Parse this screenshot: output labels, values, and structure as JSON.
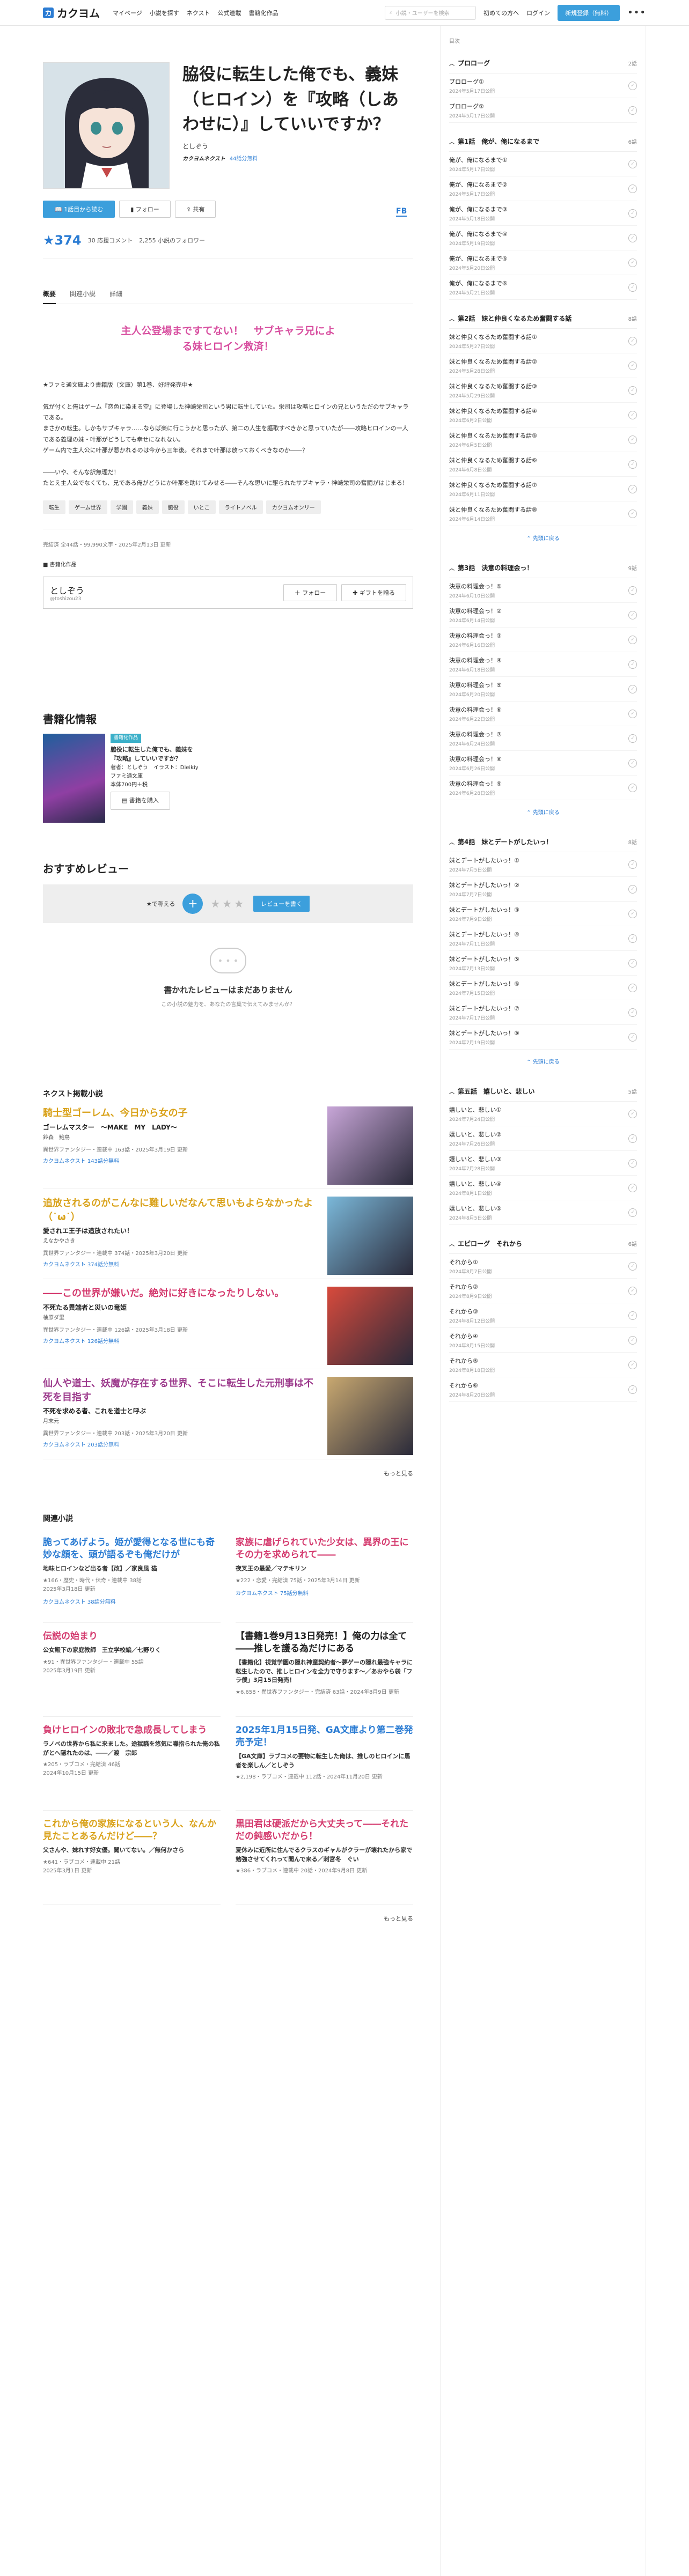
{
  "header": {
    "logo": "カクヨム",
    "nav": [
      "マイページ",
      "小説を探す",
      "ネクスト",
      "公式連載",
      "書籍化作品"
    ],
    "search_placeholder": "小説・ユーザーを検索",
    "beginner": "初めての方へ",
    "login": "ログイン",
    "signup": "新規登録（無料）"
  },
  "work": {
    "title": "脇役に転生した俺でも、義妹（ヒロイン）を『攻略（しあわせに）』していいですか？",
    "author": "としぞう",
    "badge": "カクヨムネクスト",
    "badge_sub": "44話分無料",
    "fb": "FB",
    "read_btn": "1話目から読む",
    "follow_btn": "フォロー",
    "share_btn": "共有",
    "stars": "★374",
    "comments": "30 応援コメント",
    "followers": "2,255 小説のフォロワー"
  },
  "tabs": [
    "概要",
    "関連小説",
    "詳細"
  ],
  "catchphrase": "主人公登場まですてない！　サブキャラ兄によ\nる妹ヒロイン救済！",
  "intro": "★ファミ通文庫より書籍版（文庫）第1巻、好評発売中★\n\n気が付くと俺はゲーム『恋色に染まる空』に登場した神崎栄司という男に転生していた。栄司は攻略ヒロインの兄というただのサブキャラである。\nまさかの転生。しかもサブキャラ……ならば楽に行こうかと思ったが、第二の人生を謳歌すべきかと思っていたが――攻略ヒロインの一人である義理の妹・叶那がどうしても幸せになれない。\nゲーム内で主人公に叶那が惹かれるのは今から三年後。それまで叶那は放っておくべきなのか――？\n\n――いや、そんな訳無理だ！\nたとえ主人公でなくても、兄である俺がどうにか叶那を助けてみせる――そんな思いに駆られたサブキャラ・神崎栄司の奮闘がはじまる！",
  "tags": [
    "転生",
    "ゲーム世界",
    "学園",
    "義妹",
    "脇役",
    "いとこ",
    "ライトノベル",
    "カクヨムオンリー"
  ],
  "meta": "完結済 全44話・99,990文字・2025年2月13日 更新",
  "book_flag": "書籍化作品",
  "author_box": {
    "name": "としぞう",
    "handle": "@toshizou23",
    "follow": "フォロー",
    "gift": "ギフトを贈る"
  },
  "book_section": {
    "title": "書籍化情報",
    "pill": "書籍化作品",
    "book_title": "脇役に転生した俺でも、義妹を『攻略』していいですか？",
    "by": "著者：としぞう　イラスト：Dieikiy",
    "label": "ファミ通文庫",
    "price": "本体700円＋税",
    "buy": "書籍を購入"
  },
  "review": {
    "title": "おすすめレビュー",
    "prompt": "★で称える",
    "write": "レビューを書く",
    "empty_title": "書かれたレビューはまだありません",
    "empty_sub": "この小説の魅力を、あなたの言葉で伝えてみませんか？"
  },
  "next_section": {
    "title": "ネクスト掲載小説",
    "items": [
      {
        "catch": "騎士型ゴーレム、今日から女の子",
        "title": "ゴーレムマスター　～MAKE　MY　LADY～",
        "author": "鈴森　鮑鳥",
        "meta": "異世界ファンタジー・連載中 163話・2025年3月19日 更新",
        "free": "カクヨムネクスト 143話分無料",
        "color": "#d9a21a"
      },
      {
        "catch": "追放されるのがこんなに難しいだなんて思いもよらなかったよ（˙ω˙）",
        "title": "愛されエ王子は追放されたい！",
        "author": "えなかやさき",
        "meta": "異世界ファンタジー・連載中 374話・2025年3月20日 更新",
        "free": "カクヨムネクスト 374話分無料",
        "color": "#d9a21a"
      },
      {
        "catch": "――この世界が嫌いだ。絶対に好きになったりしない。",
        "title": "不死たる異端者と災いの竜姫",
        "author": "柚原ダ里",
        "meta": "異世界ファンタジー・連載中 126話・2025年3月18日 更新",
        "free": "カクヨムネクスト 126話分無料",
        "color": "#d43a6e"
      },
      {
        "catch": "仙人や道士、妖魔が存在する世界、そこに転生した元刑事は不死を目指す",
        "title": "不死を求める者、これを道士と呼ぶ",
        "author": "月末元",
        "meta": "異世界ファンタジー・連載中 203話・2025年3月20日 更新",
        "free": "カクヨムネクスト 203話分無料",
        "color": "#9c3a8c"
      }
    ],
    "more": "もっと見る"
  },
  "related": {
    "title": "関連小説",
    "items": [
      {
        "catch": "脆ってあげよう。姫が愛得となる世にも奇妙な顔を、頭が語るぞも俺だけが",
        "title": "地味ヒロインなど出る者【改】／家良風 猫",
        "meta": "★166・歴史・時代・伝奇・連載中 38話\n2025年3月18日 更新",
        "free": "カクヨムネクスト 38話分無料",
        "color": "#2b7cd3"
      },
      {
        "catch": "家族に虐げられていた少女は、異界の王にその力を求められて――",
        "title": "夜叉王の最愛／マテキリン",
        "meta": "★222・恋愛・完結済 75話・2025年3月14日 更新",
        "free": "カクヨムネクスト 75話分無料",
        "color": "#d43a6e"
      },
      {
        "catch": "伝説の始まり",
        "title": "公女殿下の家庭教師　王立学校編／七野りく",
        "meta": "★91・異世界ファンタジー・連載中 55話\n2025年3月19日 更新",
        "free": "",
        "color": "#d43a6e"
      },
      {
        "catch": "【書籍1巻9月13日発売！】俺の力は全て――推しを護る為だけにある",
        "title": "【書籍化】視覚学園の隠れ神童契約者〜夢ゲーの隠れ最強キャラに転生したので、推しヒロインを全力で守ります〜／あおやら袋「フラ僕」3月15日発売！",
        "meta": "★6,658・異世界ファンタジー・完結済 63話・2024年8月9日 更新",
        "free": "",
        "color": "#222"
      },
      {
        "catch": "負けヒロインの敗北で急成長してしまう",
        "title": "ラノベの世界から私に来ました。途獄騒を悠気に囃指られた俺の私がとへ隠れたのは、――／渡　宗郎",
        "meta": "★205・ラブコメ・完結済 46話\n2024年10月15日 更新",
        "free": "",
        "color": "#d43a6e"
      },
      {
        "catch": "2025年1月15日発、GA文庫より第二巻発売予定！",
        "title": "【GA文庫】ラブコメの要物に転生した俺は、推しのヒロインに馬者を楽しん／としぞう",
        "meta": "★2,198・ラブコメ・連載中 112話・2024年11月20日 更新",
        "free": "",
        "color": "#2b7cd3"
      },
      {
        "catch": "これから俺の家族になるという人、なんか見たことあるんだけど――？",
        "title": "父さんや、妹れす好女優。聞いてない。／無何かさら",
        "meta": "★641・ラブコメ・連載中 21話\n2025年3月1日 更新",
        "free": "",
        "color": "#d9a21a"
      },
      {
        "catch": "黒田君は硬派だから大丈夫って――それただの鈍感いだから！",
        "title": "夏休みに近所に住んでるクラスのギャルがクラーが壊れたから家で勉強させてくれって聞んで来る／刺宮冬　ぐい",
        "meta": "★386・ラブコメ・連載中 20話・2024年9月8日 更新",
        "free": "",
        "color": "#d43a6e"
      }
    ],
    "more": "もっと見る"
  },
  "sidebar": {
    "label": "目次",
    "collapse": "先頭に戻る",
    "chapters": [
      {
        "title": "プロローグ",
        "count": "2話",
        "episodes": [
          {
            "t": "プロローグ①",
            "d": "2024年5月17日公開"
          },
          {
            "t": "プロローグ②",
            "d": "2024年5月17日公開"
          }
        ],
        "collapse": false
      },
      {
        "title": "第1話　俺が、俺になるまで",
        "count": "6話",
        "episodes": [
          {
            "t": "俺が、俺になるまで①",
            "d": "2024年5月17日公開"
          },
          {
            "t": "俺が、俺になるまで②",
            "d": "2024年5月17日公開"
          },
          {
            "t": "俺が、俺になるまで③",
            "d": "2024年5月18日公開"
          },
          {
            "t": "俺が、俺になるまで④",
            "d": "2024年5月19日公開"
          },
          {
            "t": "俺が、俺になるまで⑤",
            "d": "2024年5月20日公開"
          },
          {
            "t": "俺が、俺になるまで⑥",
            "d": "2024年5月21日公開"
          }
        ],
        "collapse": false
      },
      {
        "title": "第2話　妹と仲良くなるため奮闘する話",
        "count": "8話",
        "episodes": [
          {
            "t": "妹と仲良くなるため奮闘する話①",
            "d": "2024年5月27日公開"
          },
          {
            "t": "妹と仲良くなるため奮闘する話②",
            "d": "2024年5月28日公開"
          },
          {
            "t": "妹と仲良くなるため奮闘する話③",
            "d": "2024年5月29日公開"
          },
          {
            "t": "妹と仲良くなるため奮闘する話④",
            "d": "2024年6月2日公開"
          },
          {
            "t": "妹と仲良くなるため奮闘する話⑤",
            "d": "2024年6月5日公開"
          },
          {
            "t": "妹と仲良くなるため奮闘する話⑥",
            "d": "2024年6月8日公開"
          },
          {
            "t": "妹と仲良くなるため奮闘する話⑦",
            "d": "2024年6月11日公開"
          },
          {
            "t": "妹と仲良くなるため奮闘する話⑧",
            "d": "2024年6月14日公開"
          }
        ],
        "collapse": true
      },
      {
        "title": "第3話　決意の料理会っ！",
        "count": "9話",
        "episodes": [
          {
            "t": "決意の料理会っ！①",
            "d": "2024年6月10日公開"
          },
          {
            "t": "決意の料理会っ！②",
            "d": "2024年6月14日公開"
          },
          {
            "t": "決意の料理会っ！③",
            "d": "2024年6月16日公開"
          },
          {
            "t": "決意の料理会っ！④",
            "d": "2024年6月18日公開"
          },
          {
            "t": "決意の料理会っ！⑤",
            "d": "2024年6月20日公開"
          },
          {
            "t": "決意の料理会っ！⑥",
            "d": "2024年6月22日公開"
          },
          {
            "t": "決意の料理会っ！⑦",
            "d": "2024年6月24日公開"
          },
          {
            "t": "決意の料理会っ！⑧",
            "d": "2024年6月26日公開"
          },
          {
            "t": "決意の料理会っ！⑨",
            "d": "2024年6月28日公開"
          }
        ],
        "collapse": true
      },
      {
        "title": "第4話　妹とデートがしたいっ！",
        "count": "8話",
        "episodes": [
          {
            "t": "妹とデートがしたいっ！①",
            "d": "2024年7月5日公開"
          },
          {
            "t": "妹とデートがしたいっ！②",
            "d": "2024年7月7日公開"
          },
          {
            "t": "妹とデートがしたいっ！③",
            "d": "2024年7月9日公開"
          },
          {
            "t": "妹とデートがしたいっ！④",
            "d": "2024年7月11日公開"
          },
          {
            "t": "妹とデートがしたいっ！⑤",
            "d": "2024年7月13日公開"
          },
          {
            "t": "妹とデートがしたいっ！⑥",
            "d": "2024年7月15日公開"
          },
          {
            "t": "妹とデートがしたいっ！⑦",
            "d": "2024年7月17日公開"
          },
          {
            "t": "妹とデートがしたいっ！⑧",
            "d": "2024年7月19日公開"
          }
        ],
        "collapse": true
      },
      {
        "title": "第五話　嬉しいと、悲しい",
        "count": "5話",
        "episodes": [
          {
            "t": "嬉しいと、悲しい①",
            "d": "2024年7月24日公開"
          },
          {
            "t": "嬉しいと、悲しい②",
            "d": "2024年7月26日公開"
          },
          {
            "t": "嬉しいと、悲しい③",
            "d": "2024年7月28日公開"
          },
          {
            "t": "嬉しいと、悲しい④",
            "d": "2024年8月1日公開"
          },
          {
            "t": "嬉しいと、悲しい⑤",
            "d": "2024年8月5日公開"
          }
        ],
        "collapse": false
      },
      {
        "title": "エピローグ　それから",
        "count": "6話",
        "episodes": [
          {
            "t": "それから①",
            "d": "2024年8月7日公開"
          },
          {
            "t": "それから②",
            "d": "2024年8月9日公開"
          },
          {
            "t": "それから③",
            "d": "2024年8月12日公開"
          },
          {
            "t": "それから④",
            "d": "2024年8月15日公開"
          },
          {
            "t": "それから⑤",
            "d": "2024年8月18日公開"
          },
          {
            "t": "それから⑥",
            "d": "2024年8月20日公開"
          }
        ],
        "collapse": false
      }
    ]
  }
}
